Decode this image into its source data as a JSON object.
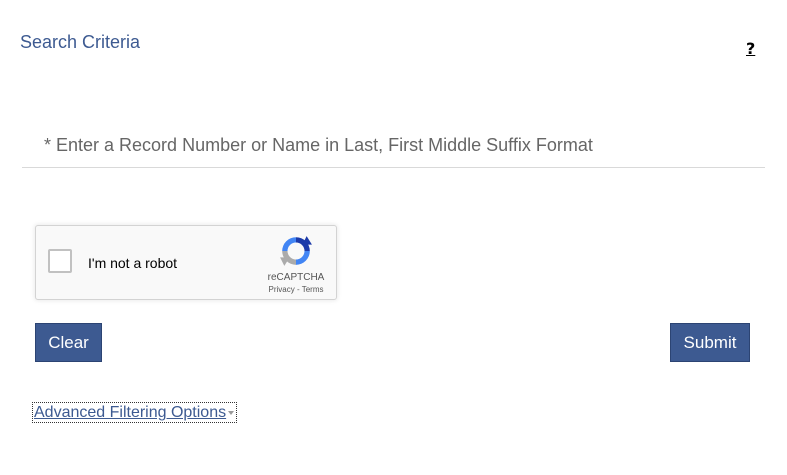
{
  "header": {
    "title": "Search Criteria",
    "help_glyph": "?"
  },
  "search": {
    "placeholder": "* Enter a Record Number or Name in Last, First Middle Suffix Format",
    "value": ""
  },
  "recaptcha": {
    "label": "I'm not a robot",
    "brand": "reCAPTCHA",
    "privacy_label": "Privacy",
    "separator": " - ",
    "terms_label": "Terms",
    "checked": false
  },
  "actions": {
    "clear_label": "Clear",
    "submit_label": "Submit"
  },
  "advanced": {
    "label": "Advanced Filtering Options"
  },
  "colors": {
    "accent": "#3d5a91",
    "button_bg": "#3d5a91",
    "button_text": "#ffffff"
  },
  "icons": {
    "help": "question-mark-icon",
    "recaptcha_logo": "recaptcha-logo-icon",
    "caret": "caret-down-icon"
  }
}
